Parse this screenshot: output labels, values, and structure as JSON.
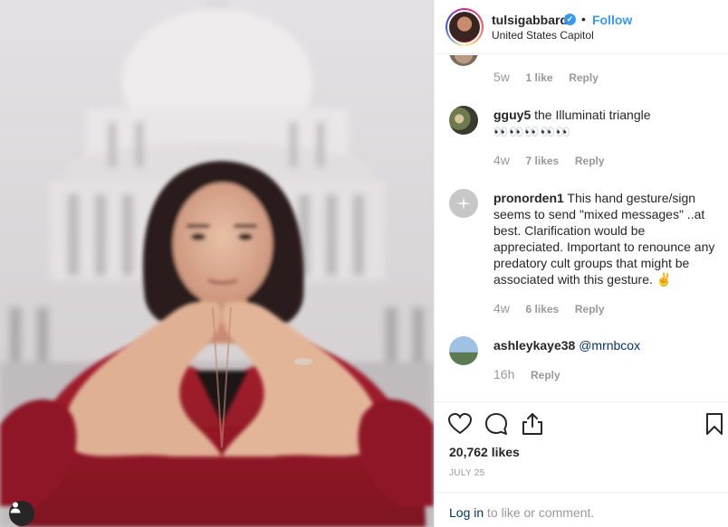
{
  "post": {
    "username": "tulsigabbard",
    "follow_label": "Follow",
    "dot": "•",
    "location": "United States Capitol",
    "verified_glyph": "✓"
  },
  "comments": [
    {
      "username": "",
      "text": "",
      "age": "5w",
      "likes": "1 like",
      "reply": "Reply"
    },
    {
      "username": "gguy5",
      "text": "the Illuminati triangle",
      "emoji": "👀👀👀👀👀",
      "age": "4w",
      "likes": "7 likes",
      "reply": "Reply"
    },
    {
      "username": "pronorden1",
      "text": "This hand gesture/sign seems to send \"mixed messages\" ..at best. Clarification would be appreciated. Important to renounce any predatory cult groups that might be associated with this gesture.",
      "emoji": "✌",
      "age": "4w",
      "likes": "6 likes",
      "reply": "Reply"
    },
    {
      "username": "ashleykaye38",
      "mention": "@mrnbcox",
      "age": "16h",
      "reply": "Reply"
    }
  ],
  "actions": {
    "icons": [
      "heart-icon",
      "comment-icon",
      "share-icon",
      "bookmark-icon"
    ],
    "likes": "20,762 likes",
    "date": "JULY 25"
  },
  "login": {
    "link": "Log in",
    "rest": " to like or comment."
  },
  "colors": {
    "accent": "#3897f0",
    "link": "#003569",
    "muted": "#999999",
    "jacket": "#9b1b2a"
  }
}
